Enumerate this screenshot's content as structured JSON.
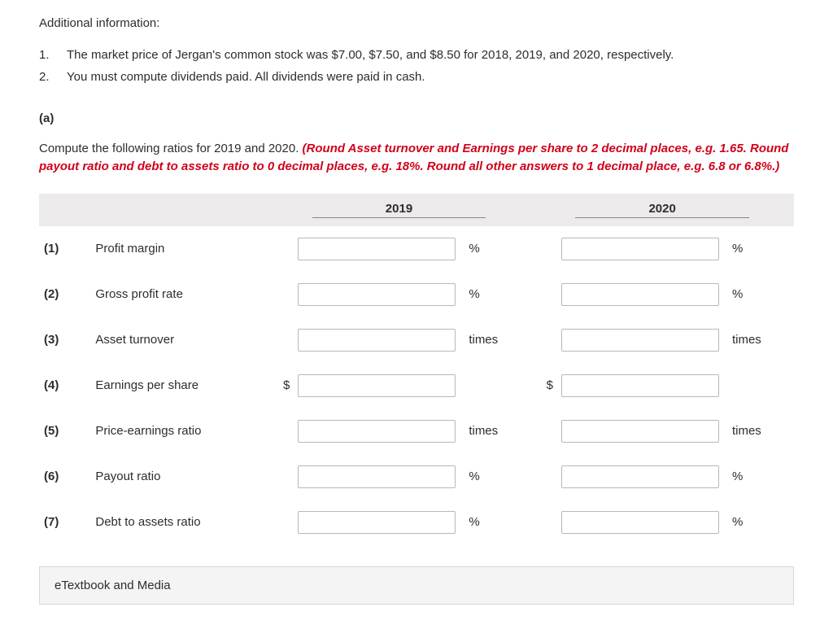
{
  "intro_title": "Additional information:",
  "info_items": [
    {
      "num": "1.",
      "text": "The market price of Jergan's common stock was $7.00, $7.50, and $8.50 for 2018, 2019, and 2020, respectively."
    },
    {
      "num": "2.",
      "text": "You must compute dividends paid. All dividends were paid in cash."
    }
  ],
  "part_label": "(a)",
  "instructions_plain": "Compute the following ratios for 2019 and 2020. ",
  "instructions_red": "(Round Asset turnover and Earnings per share to 2 decimal places, e.g. 1.65. Round payout ratio and debt to assets ratio to 0 decimal places, e.g. 18%. Round all other answers to 1 decimal place, e.g. 6.8 or 6.8%.)",
  "table": {
    "headers": {
      "year1": "2019",
      "year2": "2020"
    },
    "rows": [
      {
        "num": "(1)",
        "label": "Profit margin",
        "prefix": "",
        "unit": "%",
        "v1": "",
        "v2": ""
      },
      {
        "num": "(2)",
        "label": "Gross profit rate",
        "prefix": "",
        "unit": "%",
        "v1": "",
        "v2": ""
      },
      {
        "num": "(3)",
        "label": "Asset turnover",
        "prefix": "",
        "unit": "times",
        "v1": "",
        "v2": ""
      },
      {
        "num": "(4)",
        "label": "Earnings per share",
        "prefix": "$",
        "unit": "",
        "v1": "",
        "v2": ""
      },
      {
        "num": "(5)",
        "label": "Price-earnings ratio",
        "prefix": "",
        "unit": "times",
        "v1": "",
        "v2": ""
      },
      {
        "num": "(6)",
        "label": "Payout ratio",
        "prefix": "",
        "unit": "%",
        "v1": "",
        "v2": ""
      },
      {
        "num": "(7)",
        "label": "Debt to assets ratio",
        "prefix": "",
        "unit": "%",
        "v1": "",
        "v2": ""
      }
    ]
  },
  "etextbook_label": "eTextbook and Media"
}
